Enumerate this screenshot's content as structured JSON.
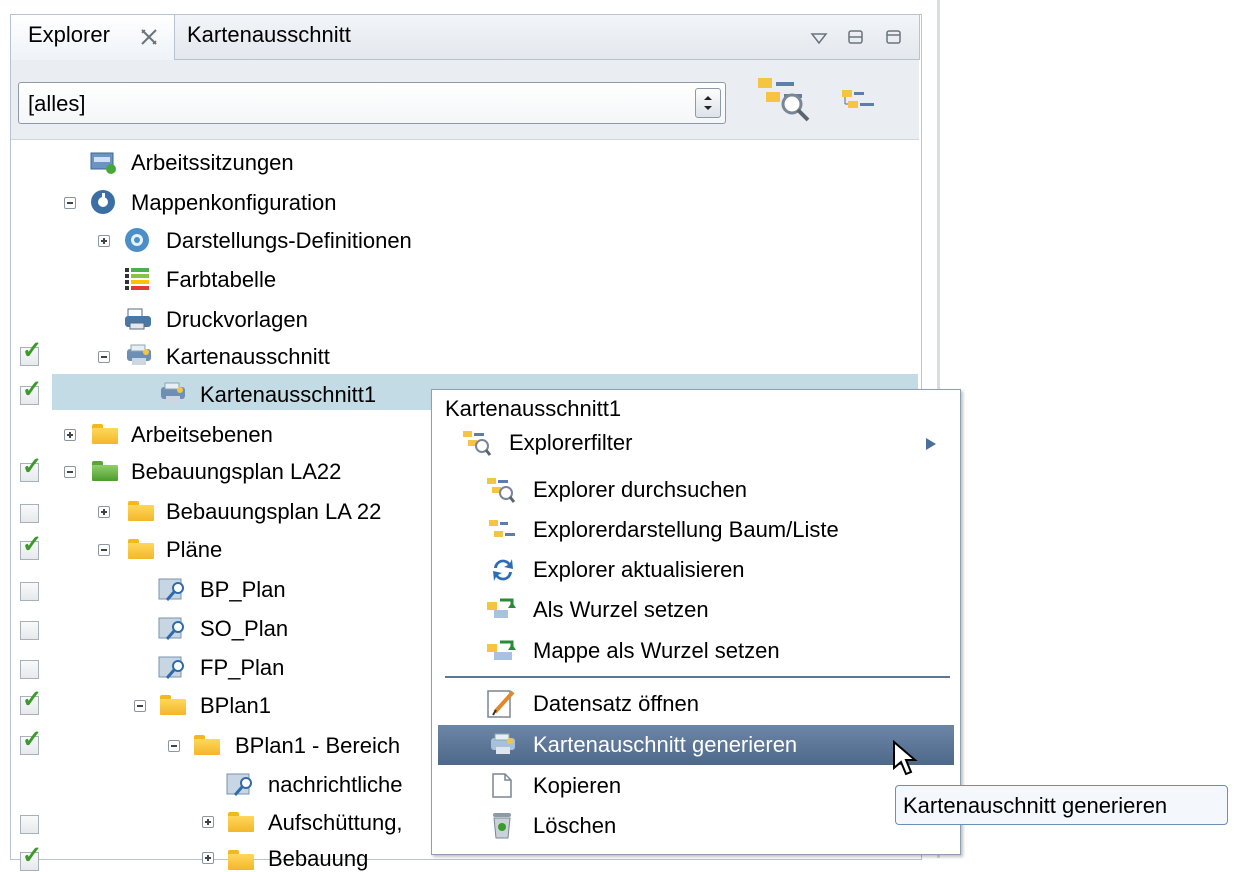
{
  "tabs": [
    {
      "label": "Explorer",
      "active": true
    },
    {
      "label": "Kartenausschnitt",
      "active": false
    }
  ],
  "window_controls": [
    "view-menu-icon",
    "minimize-icon",
    "maximize-icon"
  ],
  "filter": {
    "value": "[alles]"
  },
  "toolbar_icons": [
    "explorer-search-icon",
    "tree-list-toggle-icon"
  ],
  "tree": [
    {
      "label": "Arbeitssitzungen",
      "icon": "session-icon"
    },
    {
      "label": "Mappenkonfiguration",
      "icon": "config-icon",
      "expanded": true
    },
    {
      "label": "Darstellungs-Definitionen",
      "icon": "definitions-icon",
      "expanded": false
    },
    {
      "label": "Farbtabelle",
      "icon": "color-table-icon"
    },
    {
      "label": "Druckvorlagen",
      "icon": "printer-icon"
    },
    {
      "label": "Kartenausschnitt",
      "icon": "map-section-icon",
      "expanded": true,
      "checked": true
    },
    {
      "label": "Kartenausschnitt1",
      "icon": "map-section-icon",
      "checked": true,
      "selected": true
    },
    {
      "label": "Arbeitsebenen",
      "icon": "folder-icon",
      "expanded": false
    },
    {
      "label": "Bebauungsplan LA22",
      "icon": "folder-green-icon",
      "expanded": true,
      "checked": true
    },
    {
      "label": "Bebauungsplan LA 22",
      "icon": "folder-icon",
      "expanded": false,
      "checked": false
    },
    {
      "label": "Pläne",
      "icon": "folder-icon",
      "expanded": true,
      "checked": true
    },
    {
      "label": "BP_Plan",
      "icon": "plan-icon",
      "checked": false
    },
    {
      "label": "SO_Plan",
      "icon": "plan-icon",
      "checked": false
    },
    {
      "label": "FP_Plan",
      "icon": "plan-icon",
      "checked": false
    },
    {
      "label": "BPlan1",
      "icon": "folder-icon",
      "expanded": true,
      "checked": true
    },
    {
      "label": "BPlan1 - Bereich",
      "icon": "folder-icon",
      "expanded": true,
      "checked": true
    },
    {
      "label": "nachrichtliche",
      "icon": "plan-icon"
    },
    {
      "label": "Aufschüttung,",
      "icon": "folder-icon",
      "expanded": false,
      "checked": false
    },
    {
      "label": "Bebauung",
      "icon": "folder-icon",
      "expanded": false,
      "checked": true
    }
  ],
  "context_menu": {
    "title": "Kartenausschnitt1",
    "items": [
      {
        "label": "Explorerfilter",
        "icon": "explorer-filter-icon",
        "submenu": true
      },
      {
        "label": "Explorer durchsuchen",
        "icon": "explorer-search-icon"
      },
      {
        "label": "Explorerdarstellung Baum/Liste",
        "icon": "tree-list-icon"
      },
      {
        "label": "Explorer aktualisieren",
        "icon": "refresh-icon"
      },
      {
        "label": "Als Wurzel setzen",
        "icon": "set-root-icon"
      },
      {
        "label": "Mappe als Wurzel setzen",
        "icon": "set-folder-root-icon"
      },
      {
        "label": "Datensatz öffnen",
        "icon": "edit-record-icon"
      },
      {
        "label": "Kartenauschnitt generieren",
        "icon": "map-section-icon",
        "highlighted": true
      },
      {
        "label": "Kopieren",
        "icon": "copy-icon"
      },
      {
        "label": "Löschen",
        "icon": "delete-icon"
      }
    ]
  },
  "tooltip": "Kartenauschnitt generieren",
  "colors": {
    "selection": "#c2dbe4",
    "menu_highlight": "#5a7596",
    "check": "#3c9a2c"
  }
}
